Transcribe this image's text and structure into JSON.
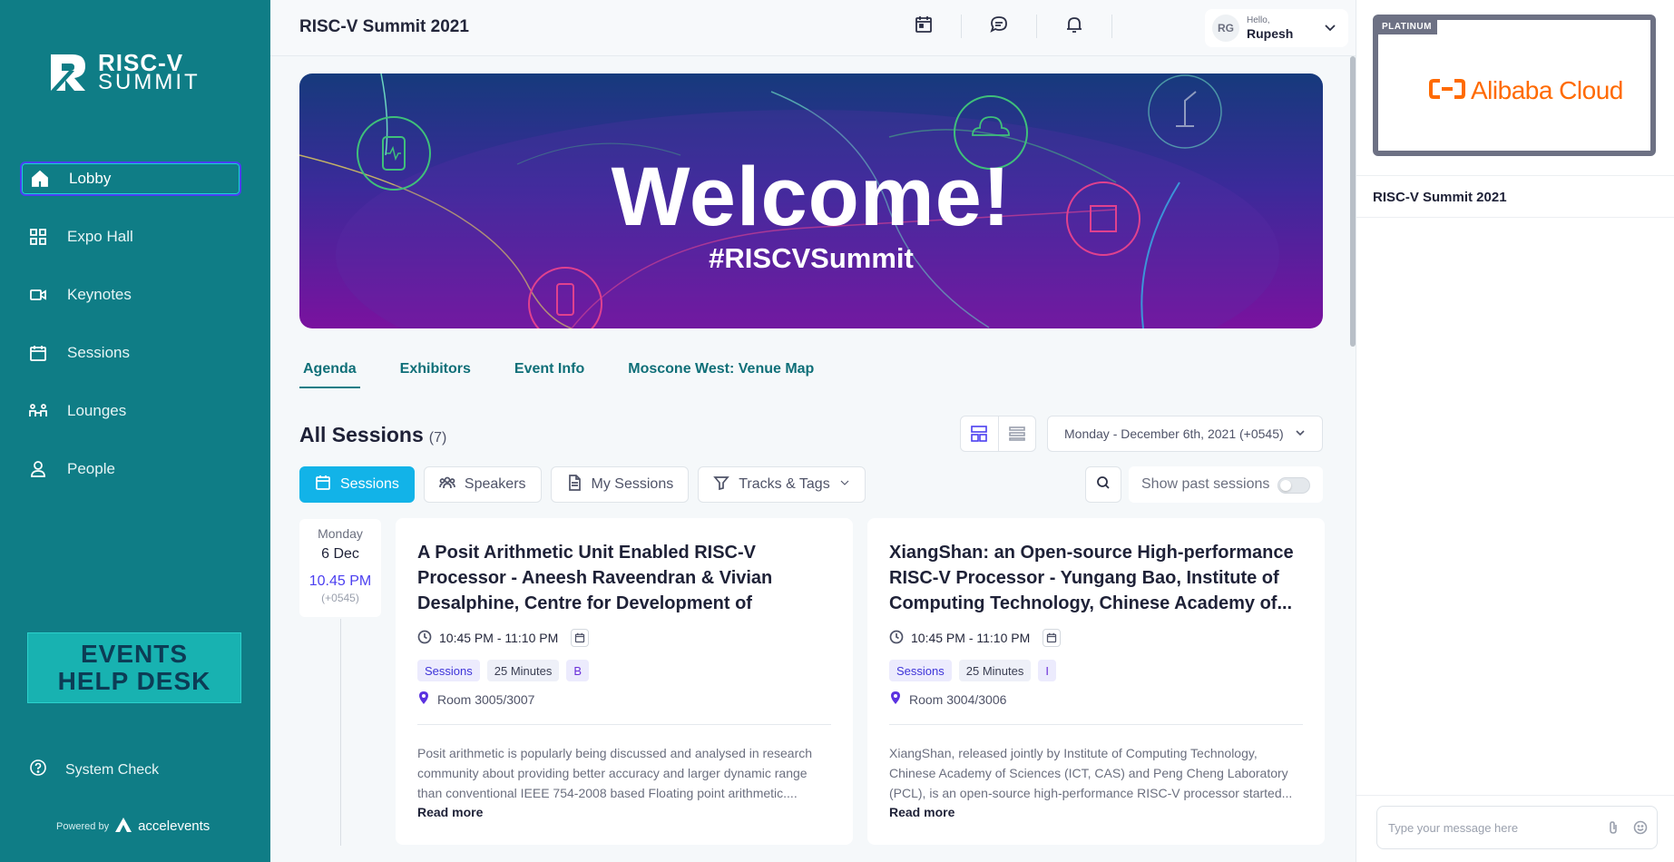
{
  "sidebar": {
    "logo_line1": "RISC-V",
    "logo_line2": "SUMMIT",
    "items": [
      {
        "label": "Lobby",
        "icon": "home-icon"
      },
      {
        "label": "Expo Hall",
        "icon": "grid-icon"
      },
      {
        "label": "Keynotes",
        "icon": "video-icon"
      },
      {
        "label": "Sessions",
        "icon": "calendar-icon"
      },
      {
        "label": "Lounges",
        "icon": "people-group-icon"
      },
      {
        "label": "People",
        "icon": "person-icon"
      }
    ],
    "helpdesk_line1": "EVENTS",
    "helpdesk_line2": "HELP DESK",
    "system_check": "System Check",
    "powered_by": "Powered by",
    "powered_brand": "accelevents"
  },
  "header": {
    "title": "RISC-V Summit 2021",
    "user_initials": "RG",
    "greeting": "Hello,",
    "user_name": "Rupesh"
  },
  "banner": {
    "headline": "Welcome!",
    "hashtag": "#RISCVSummit"
  },
  "tabs": [
    "Agenda",
    "Exhibitors",
    "Event Info",
    "Moscone West: Venue Map"
  ],
  "sessions": {
    "heading": "All Sessions",
    "count": "(7)",
    "date_filter": "Monday - December 6th, 2021 (+0545)",
    "filter_buttons": [
      "Sessions",
      "Speakers",
      "My Sessions",
      "Tracks & Tags"
    ],
    "past_label": "Show past sessions",
    "date_card": {
      "weekday": "Monday",
      "date": "6 Dec",
      "time": "10.45 PM",
      "tz": "(+0545)"
    },
    "cards": [
      {
        "title": "A Posit Arithmetic Unit Enabled RISC-V Processor - Aneesh Raveendran & Vivian Desalphine, Centre for Development of Advanced...",
        "time": "10:45 PM - 11:10 PM",
        "tags": [
          "Sessions",
          "25 Minutes",
          "B"
        ],
        "room": "Room 3005/3007",
        "description": "Posit arithmetic is popularly being discussed and analysed in research community about providing better accuracy and larger dynamic range than conventional IEEE 754-2008 based Floating point arithmetic....",
        "read_more": "Read more"
      },
      {
        "title": "XiangShan: an Open-source High-performance RISC-V Processor - Yungang Bao, Institute of Computing Technology, Chinese Academy of...",
        "time": "10:45 PM - 11:10 PM",
        "tags": [
          "Sessions",
          "25 Minutes",
          "I"
        ],
        "room": "Room 3004/3006",
        "description": "XiangShan, released jointly by Institute of Computing Technology, Chinese Academy of Sciences (ICT, CAS) and Peng Cheng Laboratory (PCL), is an open-source high-performance RISC-V processor started...",
        "read_more": "Read more"
      }
    ]
  },
  "right_panel": {
    "sponsor_tier": "PLATINUM",
    "sponsor_name": "Alibaba Cloud",
    "channel_title": "RISC-V Summit 2021",
    "chat_placeholder": "Type your message here"
  },
  "colors": {
    "sidebar": "#0f7d86",
    "primary_button": "#12b3e8",
    "accent": "#4b3ff0",
    "alibaba": "#ff6a00"
  }
}
